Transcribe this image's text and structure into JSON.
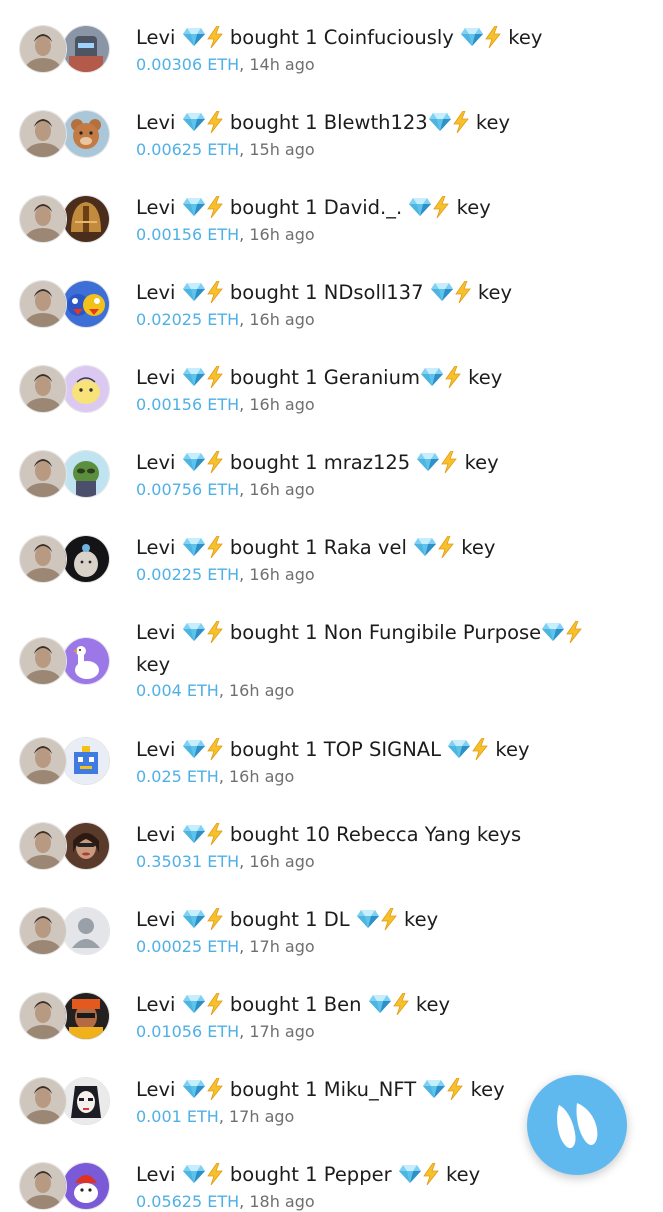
{
  "icons": {
    "gem": "gem-stone-icon",
    "bolt": "high-voltage-icon",
    "fab": "logo-button-icon"
  },
  "colors": {
    "eth": "#4fb0e6",
    "fab": "#5fb9ee",
    "text": "#1c1c1c",
    "meta": "#6f6f6f"
  },
  "feed": [
    {
      "trader": "Levi",
      "verb": "bought 1",
      "subject": "Coinfuciously",
      "subject_space": true,
      "tail": "key",
      "eth": "0.00306 ETH",
      "time": ", 14h ago",
      "avatar": "robot"
    },
    {
      "trader": "Levi",
      "verb": "bought 1",
      "subject": "Blewth123",
      "subject_space": false,
      "tail": "key",
      "eth": "0.00625 ETH",
      "time": ", 15h ago",
      "avatar": "bear"
    },
    {
      "trader": "Levi",
      "verb": "bought 1",
      "subject": "David._.",
      "subject_space": true,
      "tail": "key",
      "eth": "0.00156 ETH",
      "time": ", 16h ago",
      "avatar": "helmet"
    },
    {
      "trader": "Levi",
      "verb": "bought 1",
      "subject": "NDsoll137",
      "subject_space": true,
      "tail": "key",
      "eth": "0.02025 ETH",
      "time": ", 16h ago",
      "avatar": "birds"
    },
    {
      "trader": "Levi",
      "verb": "bought 1",
      "subject": "Geranium",
      "subject_space": false,
      "tail": "key",
      "eth": "0.00156 ETH",
      "time": ", 16h ago",
      "avatar": "yellow"
    },
    {
      "trader": "Levi",
      "verb": "bought 1",
      "subject": "mraz125",
      "subject_space": true,
      "tail": "key",
      "eth": "0.00756 ETH",
      "time": ", 16h ago",
      "avatar": "frog"
    },
    {
      "trader": "Levi",
      "verb": "bought 1",
      "subject": "Raka vel",
      "subject_space": true,
      "tail": "key",
      "eth": "0.00225 ETH",
      "time": ", 16h ago",
      "avatar": "dark"
    },
    {
      "trader": "Levi",
      "verb": "bought 1",
      "subject": "Non Fungibile Purpose",
      "subject_space": false,
      "tail": "key",
      "eth": "0.004 ETH",
      "time": ", 16h ago",
      "avatar": "goose",
      "wrap": true
    },
    {
      "trader": "Levi",
      "verb": "bought 1",
      "subject": "TOP SIGNAL",
      "subject_space": true,
      "tail": "key",
      "eth": "0.025 ETH",
      "time": ", 16h ago",
      "avatar": "pixel"
    },
    {
      "trader": "Levi",
      "verb": "bought 10",
      "subject": "Rebecca Yang keys",
      "plain": true,
      "eth": "0.35031 ETH",
      "time": ", 16h ago",
      "avatar": "woman"
    },
    {
      "trader": "Levi",
      "verb": "bought 1",
      "subject": "DL",
      "subject_space": true,
      "tail": "key",
      "eth": "0.00025 ETH",
      "time": ", 17h ago",
      "avatar": "default"
    },
    {
      "trader": "Levi",
      "verb": "bought 1",
      "subject": "Ben",
      "subject_space": true,
      "tail": "key",
      "eth": "0.01056 ETH",
      "time": ", 17h ago",
      "avatar": "ben"
    },
    {
      "trader": "Levi",
      "verb": "bought 1",
      "subject": "Miku_NFT",
      "subject_space": true,
      "tail": "key",
      "eth": "0.001 ETH",
      "time": ", 17h ago",
      "avatar": "miku"
    },
    {
      "trader": "Levi",
      "verb": "bought 1",
      "subject": "Pepper",
      "subject_space": true,
      "tail": "key",
      "eth": "0.05625 ETH",
      "time": ", 18h ago",
      "avatar": "pepper"
    }
  ]
}
